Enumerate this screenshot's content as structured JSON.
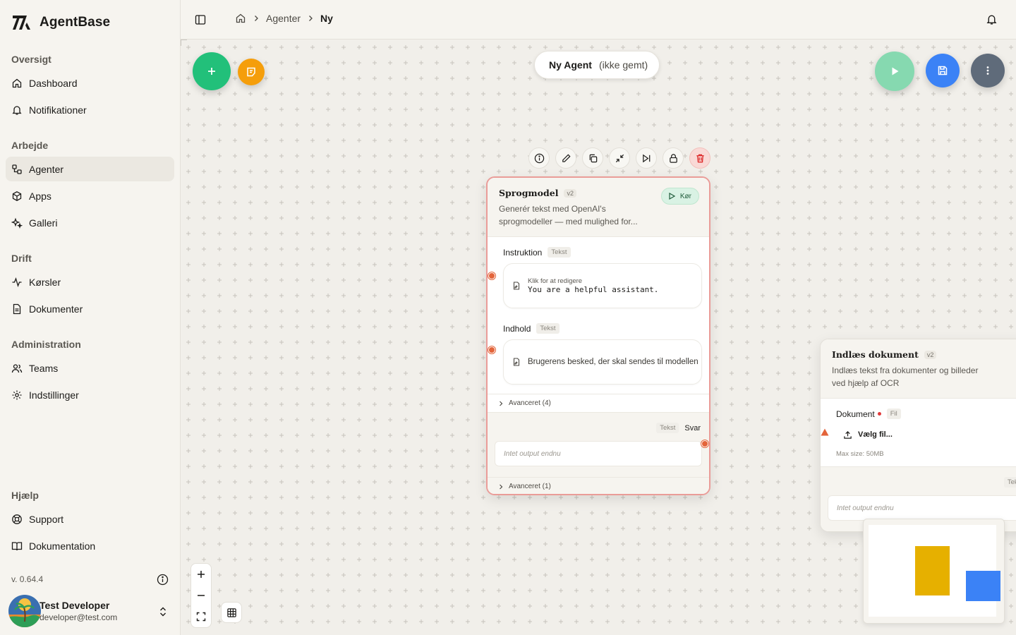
{
  "app": {
    "name": "AgentBase",
    "version": "v. 0.64.4"
  },
  "sidebar": {
    "sections": [
      {
        "title": "Oversigt",
        "items": [
          {
            "label": "Dashboard",
            "icon": "home-icon"
          },
          {
            "label": "Notifikationer",
            "icon": "bell-icon"
          }
        ]
      },
      {
        "title": "Arbejde",
        "items": [
          {
            "label": "Agenter",
            "icon": "workflow-icon",
            "active": true
          },
          {
            "label": "Apps",
            "icon": "cube-icon"
          },
          {
            "label": "Galleri",
            "icon": "sparkles-icon"
          }
        ]
      },
      {
        "title": "Drift",
        "items": [
          {
            "label": "Kørsler",
            "icon": "activity-icon"
          },
          {
            "label": "Dokumenter",
            "icon": "file-icon"
          }
        ]
      },
      {
        "title": "Administration",
        "items": [
          {
            "label": "Teams",
            "icon": "users-icon"
          },
          {
            "label": "Indstillinger",
            "icon": "gear-icon"
          }
        ]
      },
      {
        "title": "Hjælp",
        "items": [
          {
            "label": "Support",
            "icon": "lifebuoy-icon"
          },
          {
            "label": "Dokumentation",
            "icon": "book-icon"
          }
        ]
      }
    ],
    "user": {
      "name": "Test Developer",
      "email": "developer@test.com"
    }
  },
  "topbar": {
    "breadcrumbs": [
      "Agenter",
      "Ny"
    ]
  },
  "canvas": {
    "agent_name": "Ny Agent",
    "agent_state": "(ikke gemt)",
    "fab_colors": {
      "add": "#22c07a",
      "doc": "#f59e0b",
      "run": "#86d9b0",
      "save": "#3b82f6",
      "more": "#5f6b7a"
    },
    "node_main": {
      "title": "Sprogmodel",
      "version": "v2",
      "run_label": "Kør",
      "description": "Generér tekst med OpenAI's sprogmodeller — med mulighed for...",
      "field1": {
        "label": "Instruktion",
        "type": "Tekst",
        "hint": "Klik for at redigere",
        "value": "You are a helpful assistant."
      },
      "field2": {
        "label": "Indhold",
        "type": "Tekst",
        "value": "Brugerens besked, der skal sendes til modellen"
      },
      "advanced_in": "Avanceret (4)",
      "output": {
        "type": "Tekst",
        "label": "Svar",
        "empty": "Intet output endnu"
      },
      "advanced_out": "Avanceret (1)"
    },
    "node_side": {
      "title": "Indlæs dokument",
      "version": "v2",
      "description": "Indlæs tekst fra dokumenter og billeder ved hjælp af OCR",
      "field": {
        "label": "Dokument",
        "type": "Fil",
        "button": "Vælg fil...",
        "max_size": "Max size: 50MB"
      },
      "output": {
        "type": "Tekst",
        "empty": "Intet output endnu"
      }
    },
    "minimap_colors": {
      "node_a": "#e6b000",
      "node_b": "#3b82f6"
    }
  }
}
